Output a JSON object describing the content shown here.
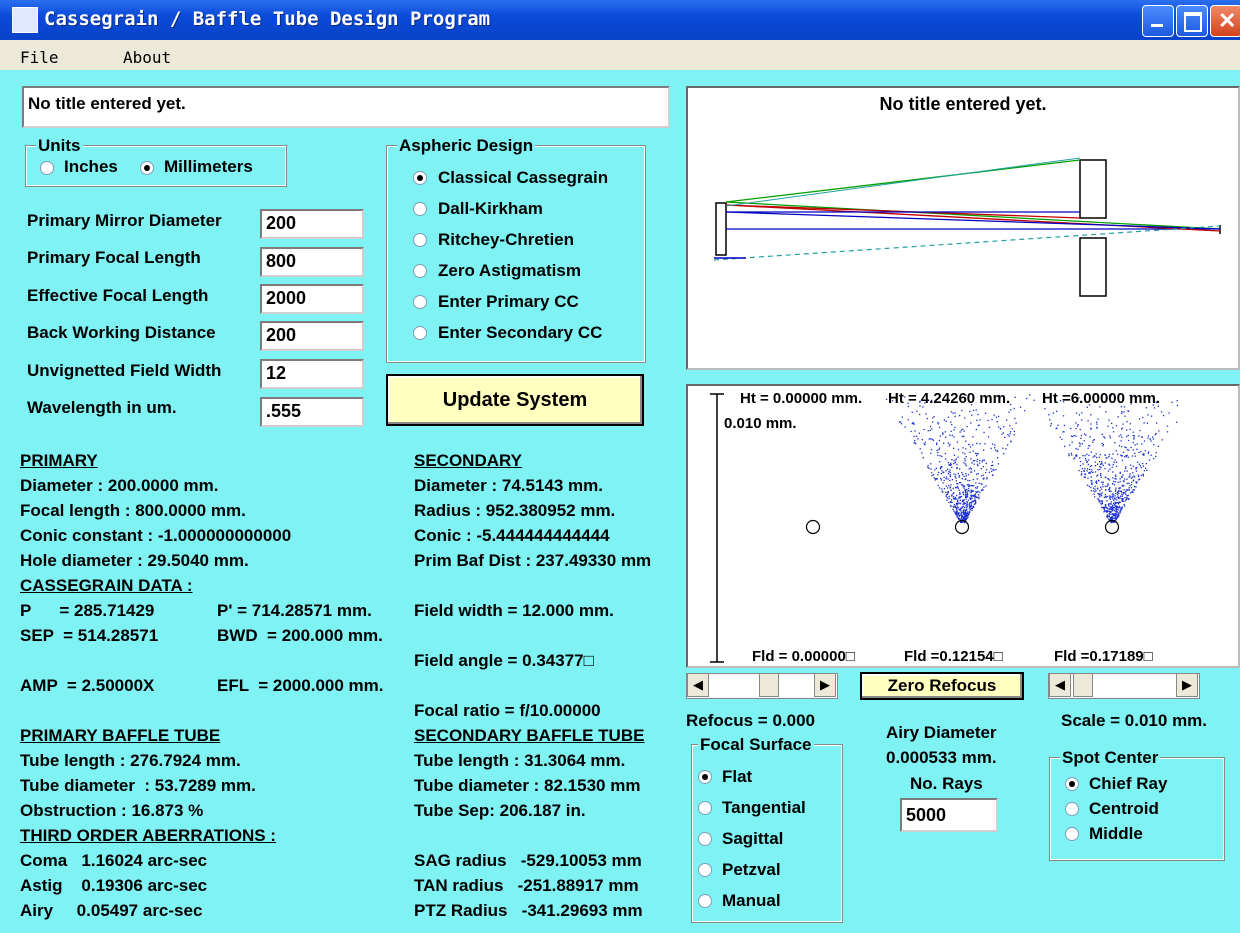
{
  "window": {
    "title": "Cassegrain / Baffle Tube Design Program"
  },
  "menu": {
    "file": "File",
    "about": "About"
  },
  "title_field": {
    "value": "No title entered yet."
  },
  "units": {
    "group_label": "Units",
    "inches": "Inches",
    "millimeters": "Millimeters",
    "selected": "Millimeters"
  },
  "params": {
    "primary_diameter": {
      "label": "Primary Mirror Diameter",
      "value": "200"
    },
    "primary_focal": {
      "label": "Primary Focal Length",
      "value": "800"
    },
    "effective_focal": {
      "label": "Effective Focal Length",
      "value": "2000"
    },
    "back_working": {
      "label": "Back Working Distance",
      "value": "200"
    },
    "field_width": {
      "label": "Unvignetted Field Width",
      "value": "12"
    },
    "wavelength": {
      "label": "Wavelength in um.",
      "value": ".555"
    }
  },
  "aspheric": {
    "group_label": "Aspheric Design",
    "options": [
      "Classical Cassegrain",
      "Dall-Kirkham",
      "Ritchey-Chretien",
      "Zero Astigmatism",
      "Enter Primary CC",
      "Enter Secondary CC"
    ],
    "selected_index": 0
  },
  "update_button": "Update System",
  "primary": {
    "heading": "PRIMARY",
    "diameter": "Diameter : 200.0000 mm.",
    "focal": "Focal length : 800.0000 mm.",
    "conic": "Conic constant : -1.000000000000",
    "hole": "Hole diameter : 29.5040 mm."
  },
  "secondary": {
    "heading": "SECONDARY",
    "diameter": "Diameter : 74.5143 mm.",
    "radius": "Radius : 952.380952 mm.",
    "conic": "Conic : -5.444444444444",
    "baf": "Prim Baf Dist : 237.49330 mm"
  },
  "cass": {
    "heading": "CASSEGRAIN DATA :",
    "p": "P      = 285.71429",
    "p_prime": "P' = 714.28571 mm.",
    "field_width": "Field width = 12.000 mm.",
    "sep": "SEP  = 514.28571",
    "bwd": "BWD  = 200.000 mm.",
    "field_angle": "Field angle = 0.34377□",
    "amp": "AMP  = 2.50000X",
    "efl": "EFL  = 2000.000 mm.",
    "focal_ratio": "Focal ratio = f/10.00000"
  },
  "primary_baffle": {
    "heading": "PRIMARY BAFFLE TUBE",
    "length": "Tube length : 276.7924 mm.",
    "diameter": "Tube diameter  : 53.7289 mm.",
    "obstruction": "Obstruction : 16.873 %"
  },
  "secondary_baffle": {
    "heading": "SECONDARY BAFFLE TUBE",
    "length": "Tube length : 31.3064 mm.",
    "diameter": "Tube diameter : 82.1530 mm",
    "sep": "Tube Sep: 206.187 in."
  },
  "aberrations": {
    "heading": "THIRD ORDER ABERRATIONS :",
    "coma": "Coma   1.16024 arc-sec",
    "astig": "Astig    0.19306 arc-sec",
    "airy": "Airy     0.05497 arc-sec",
    "sag": "SAG radius   -529.10053 mm",
    "tan": "TAN radius   -251.88917 mm",
    "ptz": "PTZ Radius   -341.29693 mm"
  },
  "diagram": {
    "title": "No title entered yet."
  },
  "spots": {
    "scale_label": "0.010 mm.",
    "heights": [
      "Ht  = 0.00000 mm.",
      "Ht = 4.24260 mm.",
      "Ht =6.00000 mm."
    ],
    "fields": [
      "Fld = 0.00000□",
      "Fld =0.12154□",
      "Fld =0.17189□"
    ]
  },
  "zero_refocus_button": "Zero Refocus",
  "refocus": "Refocus = 0.000",
  "focal_surface": {
    "group_label": "Focal Surface",
    "options": [
      "Flat",
      "Tangential",
      "Sagittal",
      "Petzval",
      "Manual"
    ],
    "selected_index": 0
  },
  "airy": {
    "label": "Airy Diameter",
    "value": "0.000533 mm."
  },
  "rays": {
    "label": "No. Rays",
    "value": "5000"
  },
  "scale": "Scale = 0.010 mm.",
  "spot_center": {
    "group_label": "Spot Center",
    "options": [
      "Chief Ray",
      "Centroid",
      "Middle"
    ],
    "selected_index": 0
  },
  "colors": {
    "accent_bg": "#7ff3f3",
    "button_yellow": "#ffffc0",
    "ray_green": "#00a000",
    "ray_blue": "#0000c0",
    "ray_red": "#c00000",
    "spot_blue": "#1a2fd0"
  }
}
